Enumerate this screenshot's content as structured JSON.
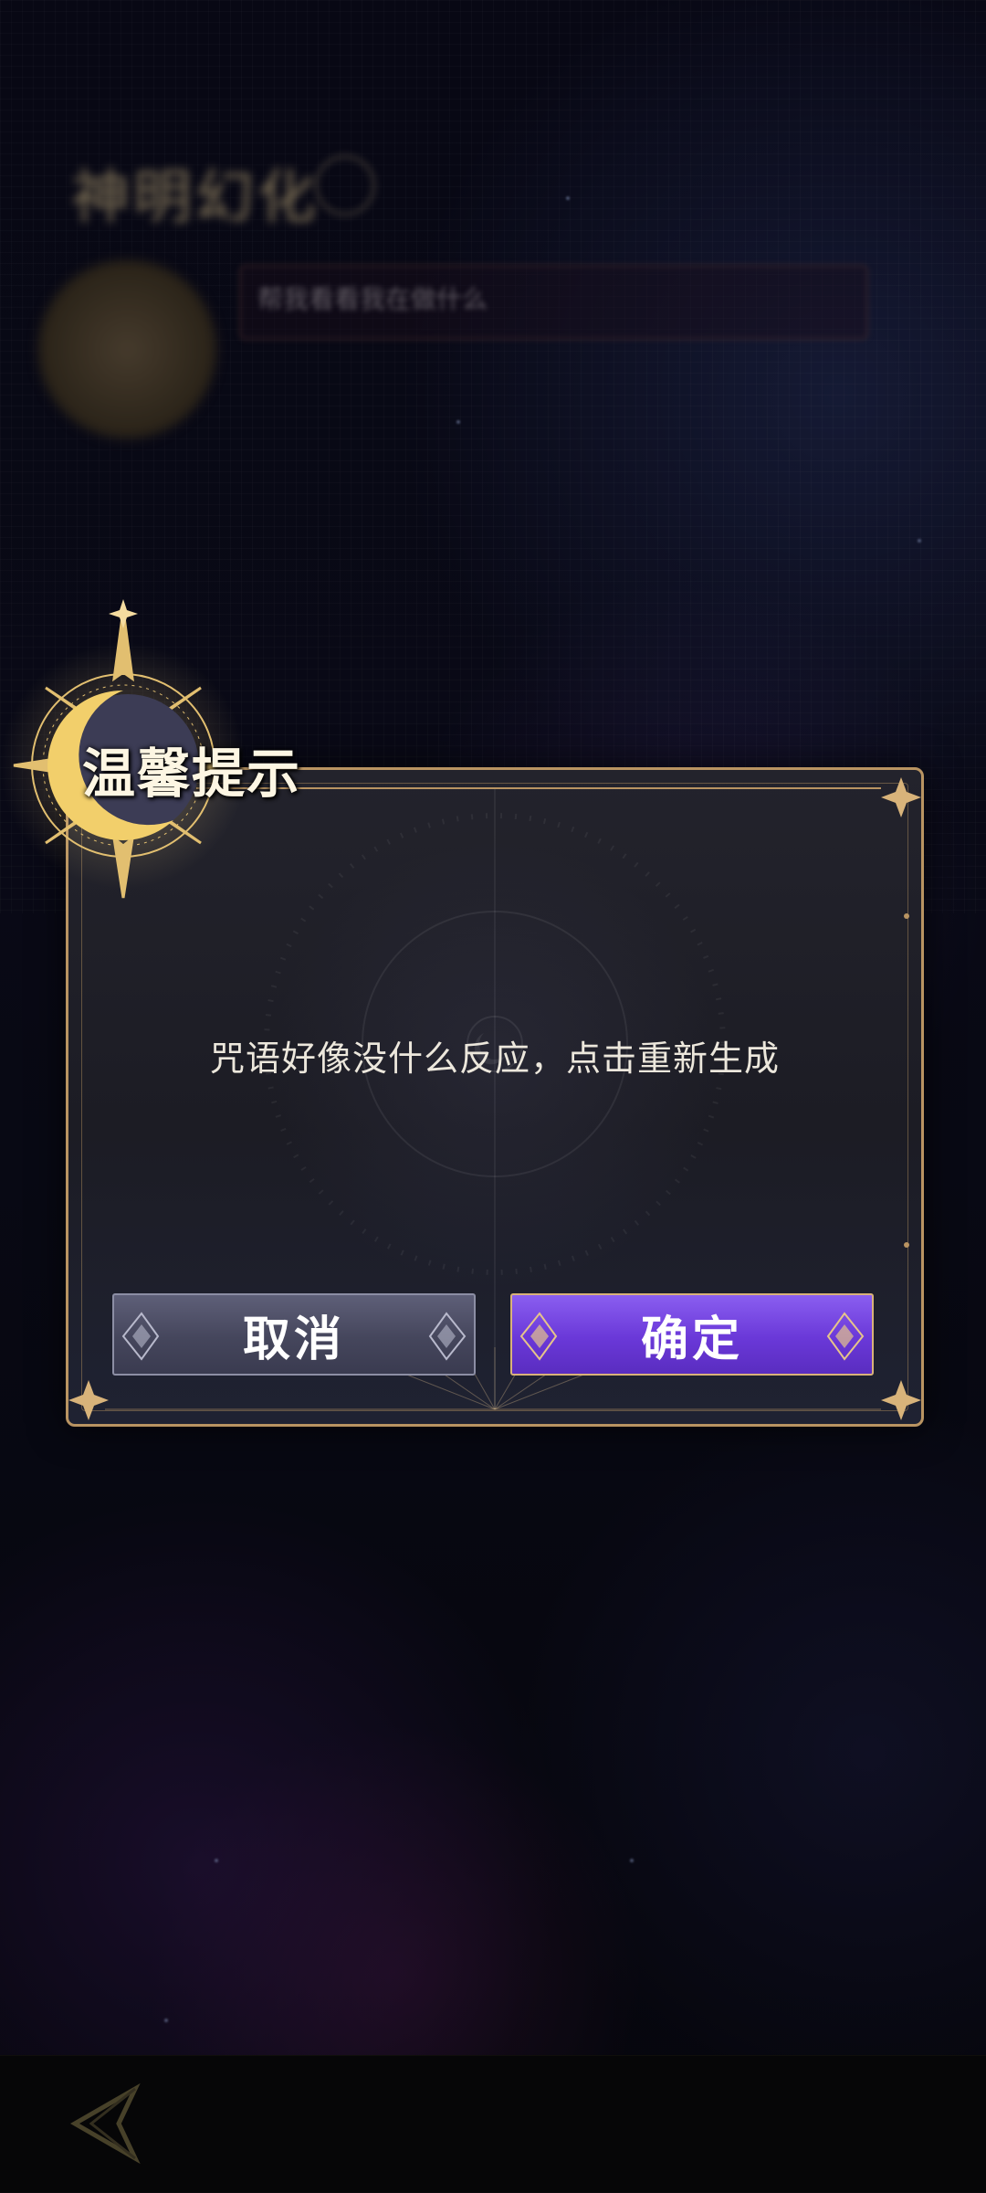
{
  "background_page": {
    "title": "神明幻化",
    "input_text": "帮我看看我在做什么"
  },
  "dialog": {
    "title": "温馨提示",
    "message": "咒语好像没什么反应，点击重新生成",
    "cancel_label": "取消",
    "confirm_label": "确定"
  },
  "icons": {
    "back": "back-arrow-icon",
    "help": "help-icon",
    "emblem": "crescent-moon-sun-icon"
  },
  "colors": {
    "accent_gold": "#b99462",
    "confirm_purple": "#6a38d8",
    "cancel_gray": "#45465c",
    "background": "#0b0b18"
  }
}
